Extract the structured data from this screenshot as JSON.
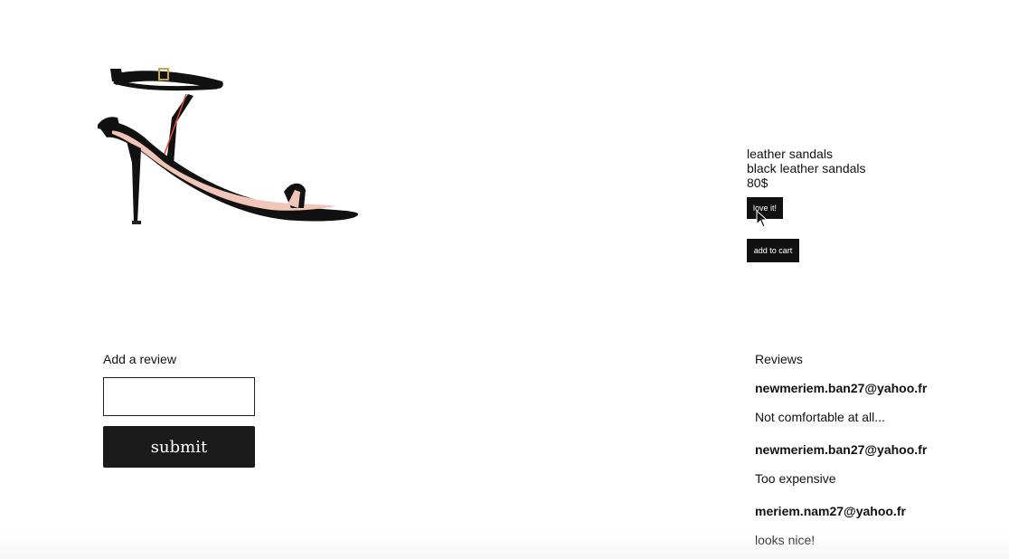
{
  "product": {
    "name": "leather sandals",
    "description": "black leather sandals",
    "price": "80$",
    "image_alt": "sandal-image",
    "love_label": "love it!",
    "cart_label": "add to cart"
  },
  "review_form": {
    "label": "Add a review",
    "input_value": "",
    "input_placeholder": "",
    "submit_label": "submit"
  },
  "reviews": {
    "heading": "Reviews",
    "items": [
      {
        "author": "newmeriem.ban27@yahoo.fr",
        "text": "Not comfortable at all..."
      },
      {
        "author": "newmeriem.ban27@yahoo.fr",
        "text": "Too expensive"
      },
      {
        "author": "meriem.nam27@yahoo.fr",
        "text": "looks nice!"
      }
    ]
  },
  "colors": {
    "button_bg": "#111111",
    "button_text": "#ffffff",
    "text": "#111111"
  },
  "icons": {
    "cursor": "mouse-pointer-icon"
  }
}
